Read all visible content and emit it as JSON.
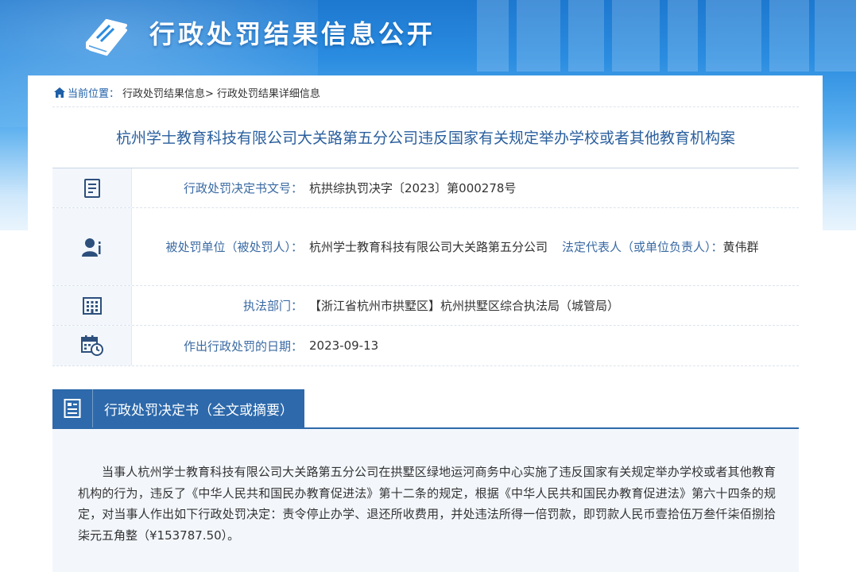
{
  "site": {
    "title": "行政处罚结果信息公开"
  },
  "breadcrumb": {
    "prefix": "当前位置：",
    "items": [
      "行政处罚结果信息>",
      "行政处罚结果详细信息"
    ]
  },
  "case_title": "杭州学士教育科技有限公司大关路第五分公司违反国家有关规定举办学校或者其他教育机构案",
  "info": {
    "doc_no": {
      "label": "行政处罚决定书文号：",
      "value": "杭拱综执罚决字〔2023〕第000278号"
    },
    "party": {
      "label": "被处罚单位（被处罚人）：",
      "value": "杭州学士教育科技有限公司大关路第五分公司",
      "rep_label": "法定代表人（或单位负责人）：",
      "rep_value": "黄伟群"
    },
    "dept": {
      "label": "执法部门：",
      "value": "【浙江省杭州市拱墅区】杭州拱墅区综合执法局（城管局）"
    },
    "date": {
      "label": "作出行政处罚的日期：",
      "value": "2023-09-13"
    }
  },
  "section": {
    "title": "行政处罚决定书（全文或摘要）"
  },
  "decision_text": "当事人杭州学士教育科技有限公司大关路第五分公司在拱墅区绿地运河商务中心实施了违反国家有关规定举办学校或者其他教育机构的行为，违反了《中华人民共和国民办教育促进法》第十二条的规定，根据《中华人民共和国民办教育促进法》第六十四条的规定，对当事人作出如下行政处罚决定：责令停止办学、退还所收费用，并处违法所得一倍罚款，即罚款人民币壹拾伍万叁仟柒佰捌拾柒元五角整（¥153787.50）。",
  "colors": {
    "accent": "#2d69ab",
    "label": "#3a6aa3",
    "title": "#2a5f9e"
  }
}
